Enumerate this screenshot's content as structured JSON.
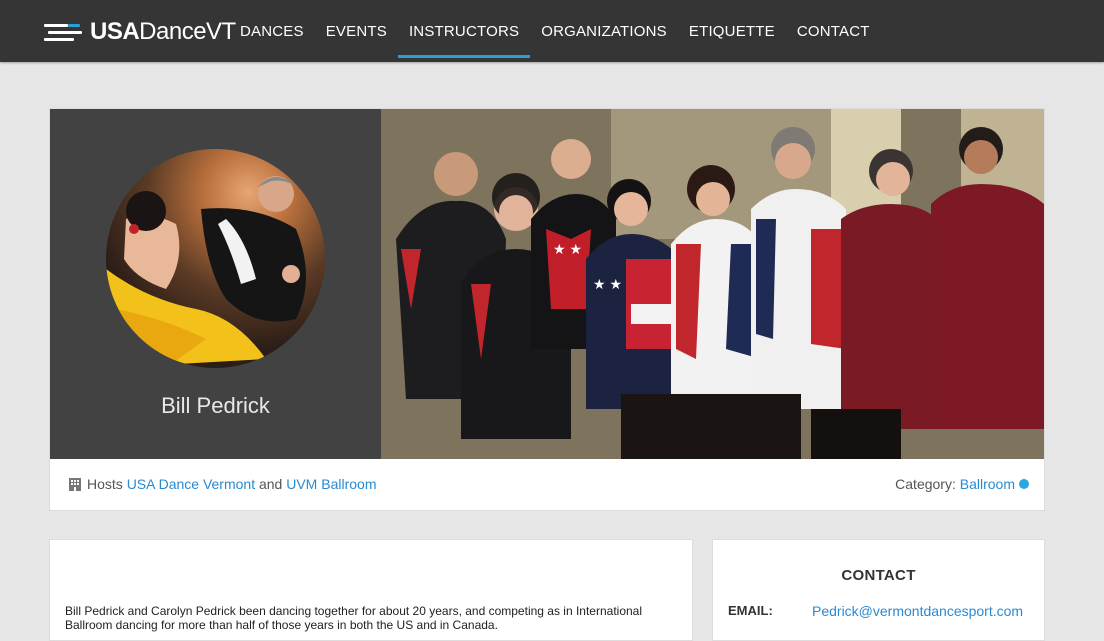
{
  "brand": {
    "bold": "USA",
    "rest": "DanceVT"
  },
  "nav": [
    {
      "label": "DANCES",
      "active": false
    },
    {
      "label": "EVENTS",
      "active": false
    },
    {
      "label": "INSTRUCTORS",
      "active": true
    },
    {
      "label": "ORGANIZATIONS",
      "active": false
    },
    {
      "label": "ETIQUETTE",
      "active": false
    },
    {
      "label": "CONTACT",
      "active": false
    }
  ],
  "colors": {
    "accent": "#2a9fd6",
    "navbar": "#353535",
    "link": "#2a8ad0"
  },
  "profile": {
    "name": "Bill Pedrick",
    "hosts_prefix": "Hosts",
    "host_1": "USA Dance Vermont",
    "hosts_joiner": "and",
    "host_2": "UVM Ballroom",
    "category_label": "Category:",
    "category_value": "Ballroom",
    "building_icon": "building-icon"
  },
  "bio": {
    "text": "Bill Pedrick and Carolyn Pedrick been dancing together for about 20 years, and competing as in International Ballroom dancing for more than half of those years in both the US and in Canada."
  },
  "contact": {
    "title": "CONTACT",
    "email_label": "EMAIL:",
    "email_value": "Pedrick@vermontdancesport.com"
  }
}
